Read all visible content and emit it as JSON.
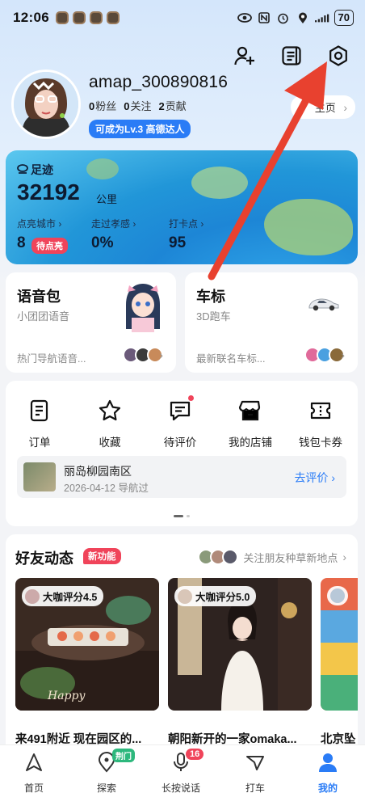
{
  "status": {
    "time": "12:06",
    "battery": "70"
  },
  "profile": {
    "username": "amap_300890816",
    "stats": [
      {
        "count": "0",
        "label": "粉丝"
      },
      {
        "count": "0",
        "label": "关注"
      },
      {
        "count": "2",
        "label": "贡献"
      }
    ],
    "level_badge": "可成为Lv.3 高德达人",
    "homepage_button": "主页"
  },
  "footprint": {
    "title": "足迹",
    "distance": "32192",
    "unit": "公里",
    "metrics": [
      {
        "label": "点亮城市",
        "value": "8",
        "badge": "待点亮"
      },
      {
        "label": "走过孝感",
        "value": "0%"
      },
      {
        "label": "打卡点",
        "value": "95"
      }
    ]
  },
  "voice_pack": {
    "title": "语音包",
    "subtitle": "小团团语音",
    "footer": "热门导航语音..."
  },
  "car_icon": {
    "title": "车标",
    "subtitle": "3D跑车",
    "footer": "最新联名车标..."
  },
  "shortcuts": {
    "items": [
      {
        "label": "订单",
        "icon": "order-icon"
      },
      {
        "label": "收藏",
        "icon": "star-icon"
      },
      {
        "label": "待评价",
        "icon": "review-icon"
      },
      {
        "label": "我的店铺",
        "icon": "store-icon"
      },
      {
        "label": "钱包卡券",
        "icon": "wallet-icon"
      }
    ],
    "pending_review": {
      "place": "丽岛柳园南区",
      "meta": "2026-04-12  导航过",
      "action": "去评价"
    }
  },
  "feed": {
    "title": "好友动态",
    "badge": "新功能",
    "link": "关注朋友种草新地点",
    "cards": [
      {
        "score": "大咖评分4.5",
        "caption": "来491附近 现在园区的..."
      },
      {
        "score": "大咖评分5.0",
        "caption": "朝阳新开的一家omaka..."
      },
      {
        "score": "",
        "caption": "北京坠"
      }
    ]
  },
  "tabbar": {
    "tabs": [
      {
        "label": "首页"
      },
      {
        "label": "探索",
        "badge": "荆门"
      },
      {
        "label": "长按说话",
        "badge": "16"
      },
      {
        "label": "打车"
      },
      {
        "label": "我的"
      }
    ]
  },
  "colors": {
    "accent": "#2a7cf6",
    "badge_red": "#f0445a",
    "arrow_red": "#e8412f"
  }
}
